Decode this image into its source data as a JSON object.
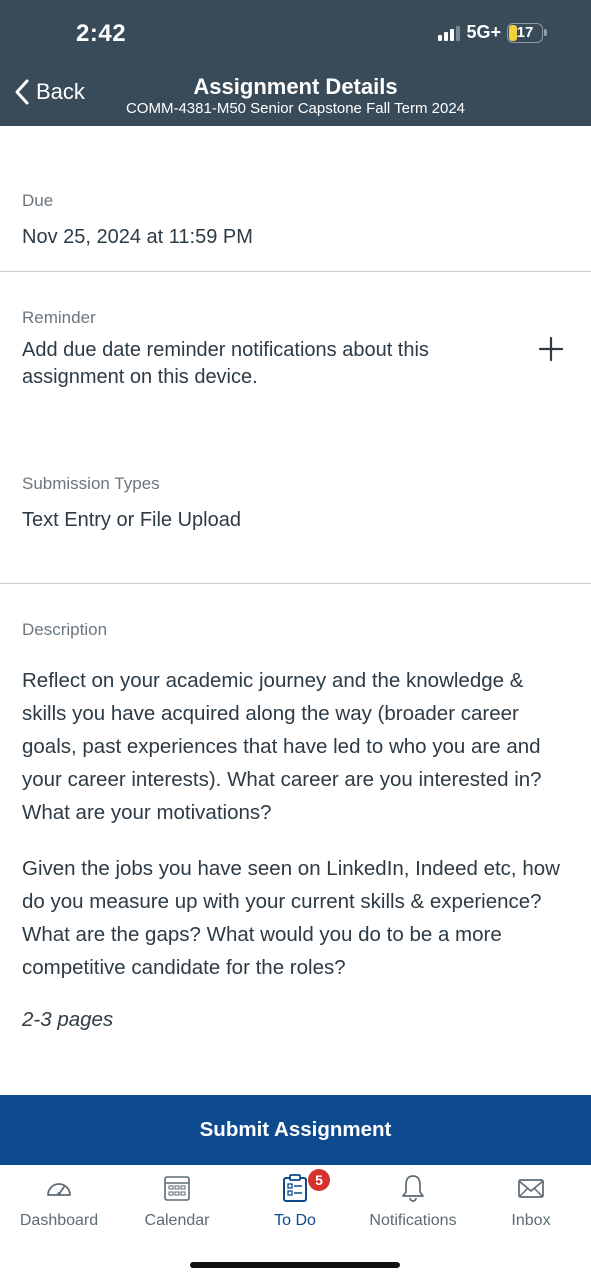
{
  "status_bar": {
    "time": "2:42",
    "network": "5G+",
    "battery": "17"
  },
  "nav": {
    "back_label": "Back",
    "title": "Assignment Details",
    "subtitle": "COMM-4381-M50 Senior Capstone Fall Term 2024"
  },
  "due": {
    "label": "Due",
    "value": "Nov 25, 2024 at 11:59 PM"
  },
  "reminder": {
    "label": "Reminder",
    "text": "Add due date reminder notifications about this assignment on this device."
  },
  "submission_types": {
    "label": "Submission Types",
    "value": "Text Entry or File Upload"
  },
  "description": {
    "label": "Description",
    "paragraphs": [
      "Reflect on your academic journey and the knowledge & skills you have acquired along the way (broader career goals, past experiences that have led to who you are and your career interests). What career are you interested in? What are your motivations?",
      "Given the jobs you have seen on LinkedIn, Indeed etc, how do you measure up with your current skills & experience? What are the gaps? What would you do to be a more competitive candidate for the roles?"
    ],
    "length_note": "2-3 pages"
  },
  "submit_button": "Submit Assignment",
  "tab_bar": {
    "tabs": [
      {
        "label": "Dashboard",
        "icon": "dashboard-icon"
      },
      {
        "label": "Calendar",
        "icon": "calendar-icon"
      },
      {
        "label": "To Do",
        "icon": "todo-icon",
        "badge": "5",
        "active": true
      },
      {
        "label": "Notifications",
        "icon": "bell-icon"
      },
      {
        "label": "Inbox",
        "icon": "envelope-icon"
      }
    ]
  },
  "colors": {
    "header_bg": "#394b58",
    "submit_bg": "#0e4a8e",
    "badge": "#d5322f",
    "battery_low": "#f4d03f"
  }
}
